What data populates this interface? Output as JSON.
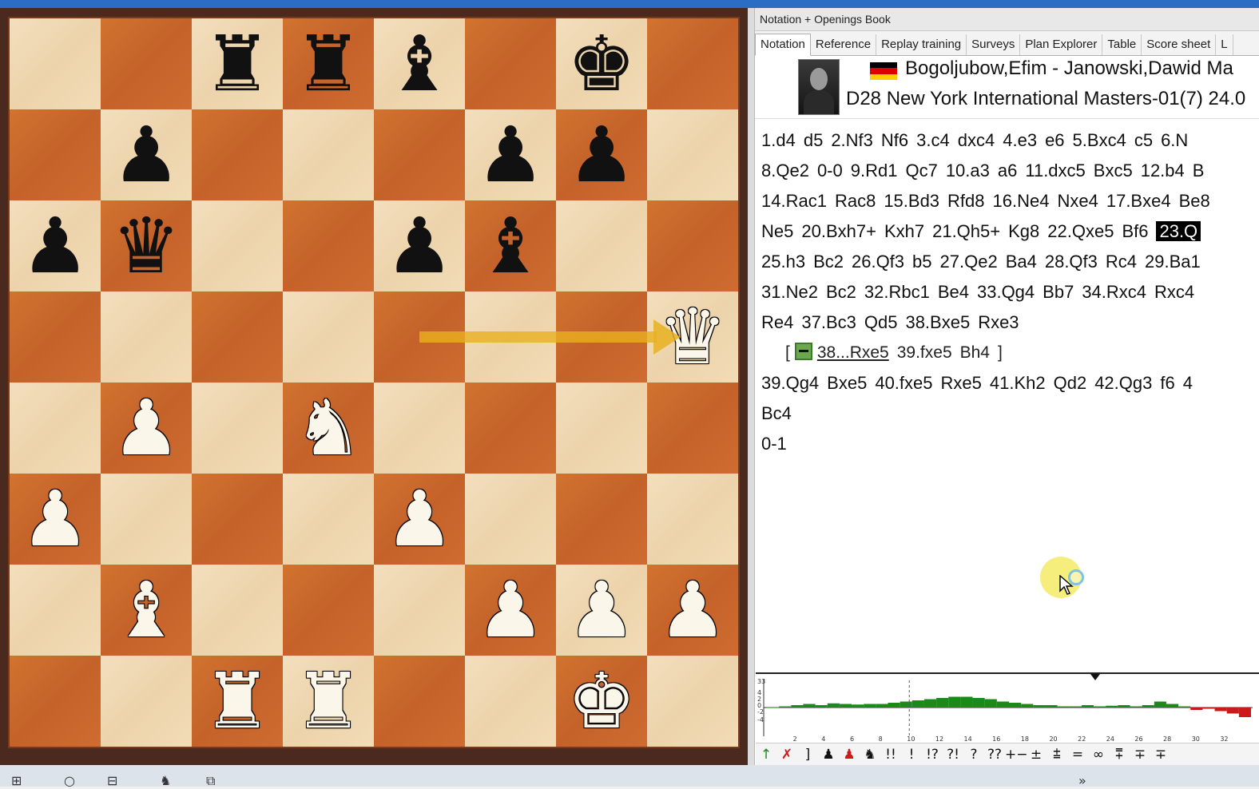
{
  "window": {
    "title": "Notation + Openings Book"
  },
  "tabs": [
    {
      "label": "Notation",
      "active": true
    },
    {
      "label": "Reference",
      "active": false
    },
    {
      "label": "Replay training",
      "active": false
    },
    {
      "label": "Surveys",
      "active": false
    },
    {
      "label": "Plan Explorer",
      "active": false
    },
    {
      "label": "Table",
      "active": false
    },
    {
      "label": "Score sheet",
      "active": false
    },
    {
      "label": "L",
      "active": false
    }
  ],
  "game": {
    "players": "Bogoljubow,Efim - Janowski,Dawid Ma",
    "event": "D28 New York International Masters-01(7) 24.0",
    "flag_colors": [
      "#000000",
      "#dd0000",
      "#ffce00"
    ]
  },
  "notation": {
    "lines": [
      [
        "1.d4",
        "d5",
        "2.Nf3",
        "Nf6",
        "3.c4",
        "dxc4",
        "4.e3",
        "e6",
        "5.Bxc4",
        "c5",
        "6.N"
      ],
      [
        "8.Qe2",
        "0-0",
        "9.Rd1",
        "Qc7",
        "10.a3",
        "a6",
        "11.dxc5",
        "Bxc5",
        "12.b4",
        "B"
      ],
      [
        "14.Rac1",
        "Rac8",
        "15.Bd3",
        "Rfd8",
        "16.Ne4",
        "Nxe4",
        "17.Bxe4",
        "Be8"
      ],
      [
        "Ne5",
        "20.Bxh7+",
        "Kxh7",
        "21.Qh5+",
        "Kg8",
        "22.Qxe5",
        "Bf6",
        "23.Q"
      ],
      [
        "25.h3",
        "Bc2",
        "26.Qf3",
        "b5",
        "27.Qe2",
        "Ba4",
        "28.Qf3",
        "Rc4",
        "29.Ba1"
      ],
      [
        "31.Ne2",
        "Bc2",
        "32.Rbc1",
        "Be4",
        "33.Qg4",
        "Bb7",
        "34.Rxc4",
        "Rxc4"
      ],
      [
        "Re4",
        "37.Bc3",
        "Qd5",
        "38.Bxe5",
        "Rxe3"
      ],
      [
        "39.Qg4",
        "Bxe5",
        "40.fxe5",
        "Rxe5",
        "41.Kh2",
        "Qd2",
        "42.Qg3",
        "f6",
        "4"
      ],
      [
        "Bc4"
      ],
      [
        "0-1"
      ]
    ],
    "current_move": "23.Q",
    "variation": {
      "open": "[",
      "moves": [
        "38...Rxe5",
        "39.fxe5",
        "Bh4"
      ],
      "close": "]"
    }
  },
  "board": {
    "rows": [
      [
        "",
        "",
        "bR",
        "bR",
        "bB",
        "",
        "bK",
        ""
      ],
      [
        "",
        "bP",
        "",
        "",
        "",
        "bP",
        "bP",
        ""
      ],
      [
        "bP",
        "bQ",
        "",
        "",
        "bP",
        "bB",
        "",
        ""
      ],
      [
        "",
        "",
        "",
        "",
        "",
        "",
        "",
        "wQ"
      ],
      [
        "",
        "wP",
        "",
        "wN",
        "",
        "",
        "",
        ""
      ],
      [
        "wP",
        "",
        "",
        "",
        "wP",
        "",
        "",
        ""
      ],
      [
        "",
        "wB",
        "",
        "",
        "",
        "wP",
        "wP",
        "wP"
      ],
      [
        "",
        "",
        "wR",
        "wR",
        "",
        "",
        "wK",
        ""
      ]
    ],
    "glyphs": {
      "K": "♚",
      "Q": "♛",
      "R": "♜",
      "B": "♝",
      "N": "♞",
      "P": "♟"
    },
    "arrow": {
      "from": "e5",
      "to": "h5",
      "color": "#e8b020"
    }
  },
  "eval_graph": {
    "y_labels": [
      "33",
      "4",
      "2",
      "0",
      "-2",
      "-4"
    ],
    "x_labels": [
      "2",
      "4",
      "6",
      "8",
      "10",
      "12",
      "14",
      "16",
      "18",
      "20",
      "22",
      "24",
      "26",
      "28",
      "30",
      "32"
    ],
    "values": [
      0,
      0.1,
      0.2,
      0.3,
      0.2,
      0.35,
      0.3,
      0.25,
      0.3,
      0.3,
      0.4,
      0.5,
      0.6,
      0.7,
      0.8,
      0.9,
      0.9,
      0.8,
      0.7,
      0.5,
      0.4,
      0.3,
      0.2,
      0.2,
      0.1,
      0.1,
      0.2,
      0.1,
      0.15,
      0.2,
      0.1,
      0.2,
      0.5,
      0.3,
      0.1,
      -0.2,
      -0.1,
      -0.3,
      -0.5,
      -0.8
    ],
    "marker_move": 10,
    "positive_color": "#1a8a1a",
    "negative_color": "#cc1a1a"
  },
  "eval_toolbar": {
    "buttons": [
      "↑",
      "✗",
      "]",
      "♟",
      "♟",
      "♞",
      "!!",
      "!",
      "!?",
      "?!",
      "?",
      "??",
      "+−",
      "±",
      "⩲",
      "=",
      "∞",
      "⩱",
      "∓",
      "∓"
    ]
  },
  "taskbar": {
    "icons": [
      "⊞",
      "○",
      "⊟",
      "♞",
      "⧉",
      "»"
    ]
  }
}
